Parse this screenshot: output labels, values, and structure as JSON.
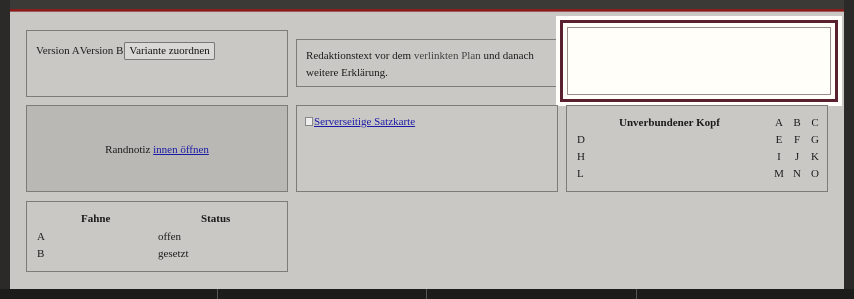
{
  "version_cell": {
    "label_a": "Version A",
    "label_b": "Version B",
    "assign_button": "Variante zuordnen"
  },
  "editorial": {
    "text_before": "Redaktionstext vor dem ",
    "link": "verlinkten Plan",
    "text_after": " und danach weitere Erklärung."
  },
  "margin_note": {
    "text": "Randnotiz ",
    "link": "innen öffnen"
  },
  "map": {
    "alt": "Serverseitige Satzkarte"
  },
  "unbound_table": {
    "header": "Unverbundener Kopf",
    "columns": [
      "A",
      "B",
      "C"
    ],
    "rows": [
      {
        "label": "D",
        "cells": [
          "E",
          "F",
          "G"
        ]
      },
      {
        "label": "H",
        "cells": [
          "I",
          "J",
          "K"
        ]
      },
      {
        "label": "L",
        "cells": [
          "M",
          "N",
          "O"
        ]
      }
    ]
  },
  "status_table": {
    "headers": [
      "Fahne",
      "Status"
    ],
    "rows": [
      {
        "flag": "A",
        "status": "offen"
      },
      {
        "flag": "B",
        "status": "gesetzt"
      }
    ]
  },
  "colors": {
    "page_bg": "#c9c8c4",
    "accent_red": "#8a1b1b",
    "focus_ring": "#5a2030",
    "link": "#1a1aa6"
  }
}
